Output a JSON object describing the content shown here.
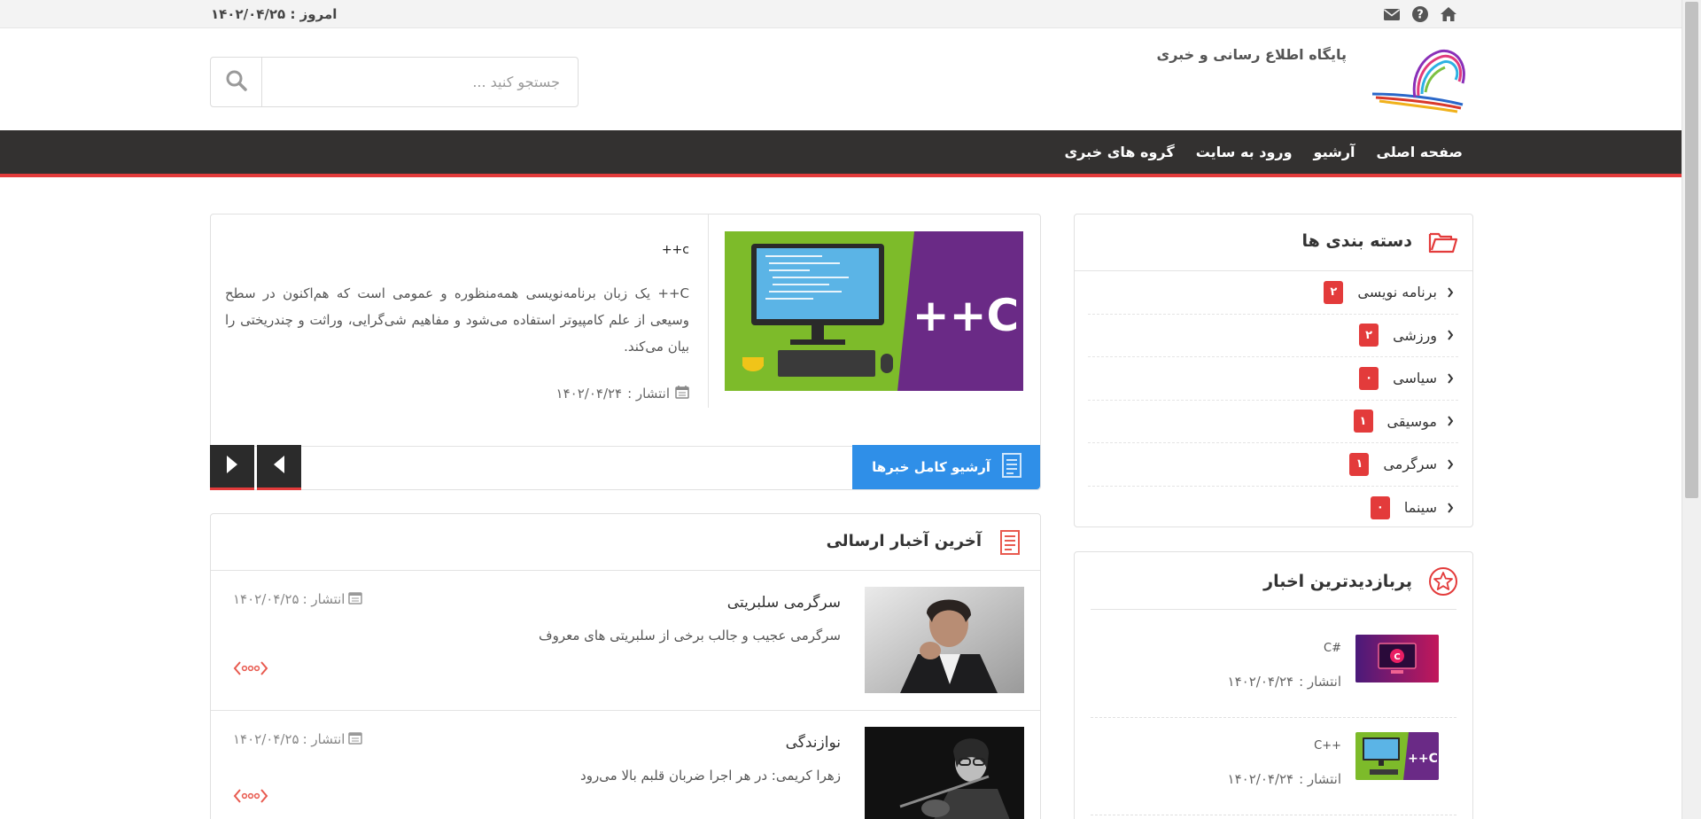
{
  "topbar": {
    "date_label": "امروز :",
    "date_value": "۱۴۰۲/۰۴/۲۵",
    "icons": [
      "home-icon",
      "help-icon",
      "mail-icon"
    ]
  },
  "header": {
    "site_title": "پایگاه اطلاع رسانی و خبری",
    "search_placeholder": "جستجو کنید ..."
  },
  "nav": {
    "items": [
      "صفحه اصلی",
      "آرشیو",
      "ورود به سایت",
      "گروه های خبری"
    ]
  },
  "slider": {
    "title": "++c",
    "text": "C++ یک زبان برنامه‌نویسی همه‌منظوره و عمومی است که هم‌اکنون در سطح وسیعی از علم کامپیوتر استفاده می‌شود و مفاهیم شی‌گرایی، وراثت و چندریختی را بیان می‌کند.",
    "meta_label": "انتشار :",
    "meta_date": "۱۴۰۲/۰۴/۲۴",
    "image_text": "C++",
    "archive_button": "آرشیو کامل خبرها"
  },
  "latest": {
    "title": "آخرین آخبار ارسالی",
    "items": [
      {
        "title": "سرگرمی سلبریتی",
        "desc": "سرگرمی عجیب و جالب برخی از سلبریتی های معروف",
        "meta_label": "انتشار :",
        "meta_date": "۱۴۰۲/۰۴/۲۵"
      },
      {
        "title": "نوازندگی",
        "desc": "زهرا کریمی: در هر اجرا ضربان قلبم بالا می‌رود",
        "meta_label": "انتشار :",
        "meta_date": "۱۴۰۲/۰۴/۲۵"
      }
    ]
  },
  "categories": {
    "title": "دسته بندی ها",
    "items": [
      {
        "name": "برنامه نویسی",
        "count": "۲"
      },
      {
        "name": "ورزشی",
        "count": "۲"
      },
      {
        "name": "سیاسی",
        "count": "۰"
      },
      {
        "name": "موسیقی",
        "count": "۱"
      },
      {
        "name": "سرگرمی",
        "count": "۱"
      },
      {
        "name": "سینما",
        "count": "۰"
      }
    ]
  },
  "most_viewed": {
    "title": "پربازدیدترین اخبار",
    "items": [
      {
        "title": "C#",
        "meta_label": "انتشار :",
        "meta_date": "۱۴۰۲/۰۴/۲۴"
      },
      {
        "title": "C++",
        "meta_label": "انتشار :",
        "meta_date": "۱۴۰۲/۰۴/۲۴"
      }
    ]
  },
  "colors": {
    "accent_red": "#e33b3b",
    "nav_bg": "#333130",
    "button_blue": "#2f8fe8"
  }
}
